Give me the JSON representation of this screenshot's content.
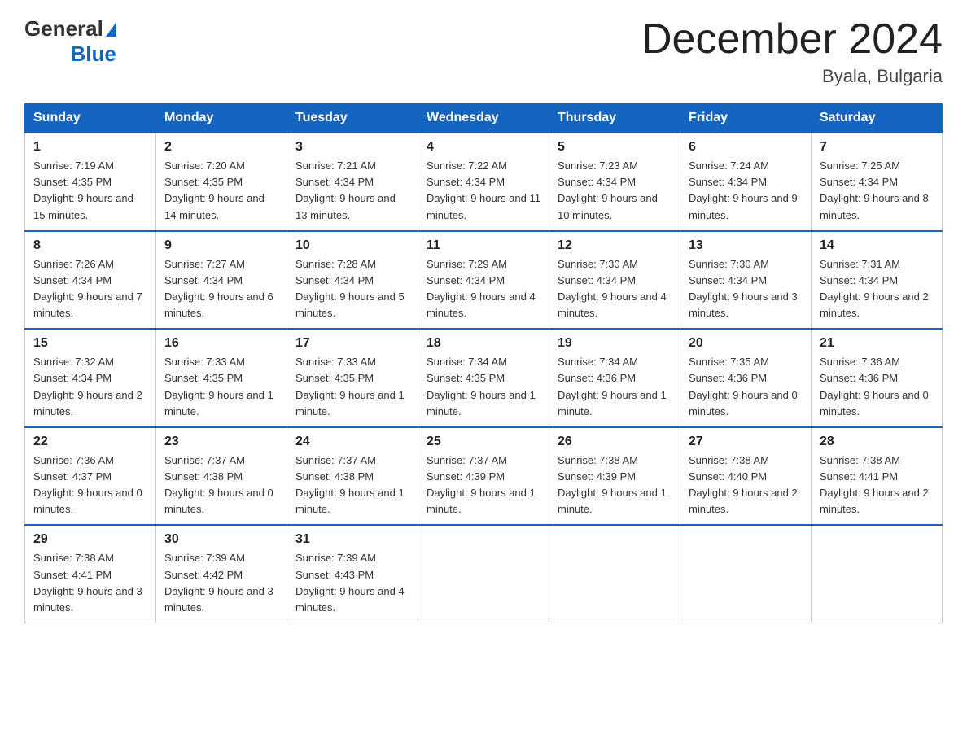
{
  "header": {
    "logo_general": "General",
    "logo_blue": "Blue",
    "title": "December 2024",
    "location": "Byala, Bulgaria"
  },
  "days_of_week": [
    "Sunday",
    "Monday",
    "Tuesday",
    "Wednesday",
    "Thursday",
    "Friday",
    "Saturday"
  ],
  "weeks": [
    [
      {
        "day": "1",
        "sunrise": "7:19 AM",
        "sunset": "4:35 PM",
        "daylight": "9 hours and 15 minutes."
      },
      {
        "day": "2",
        "sunrise": "7:20 AM",
        "sunset": "4:35 PM",
        "daylight": "9 hours and 14 minutes."
      },
      {
        "day": "3",
        "sunrise": "7:21 AM",
        "sunset": "4:34 PM",
        "daylight": "9 hours and 13 minutes."
      },
      {
        "day": "4",
        "sunrise": "7:22 AM",
        "sunset": "4:34 PM",
        "daylight": "9 hours and 11 minutes."
      },
      {
        "day": "5",
        "sunrise": "7:23 AM",
        "sunset": "4:34 PM",
        "daylight": "9 hours and 10 minutes."
      },
      {
        "day": "6",
        "sunrise": "7:24 AM",
        "sunset": "4:34 PM",
        "daylight": "9 hours and 9 minutes."
      },
      {
        "day": "7",
        "sunrise": "7:25 AM",
        "sunset": "4:34 PM",
        "daylight": "9 hours and 8 minutes."
      }
    ],
    [
      {
        "day": "8",
        "sunrise": "7:26 AM",
        "sunset": "4:34 PM",
        "daylight": "9 hours and 7 minutes."
      },
      {
        "day": "9",
        "sunrise": "7:27 AM",
        "sunset": "4:34 PM",
        "daylight": "9 hours and 6 minutes."
      },
      {
        "day": "10",
        "sunrise": "7:28 AM",
        "sunset": "4:34 PM",
        "daylight": "9 hours and 5 minutes."
      },
      {
        "day": "11",
        "sunrise": "7:29 AM",
        "sunset": "4:34 PM",
        "daylight": "9 hours and 4 minutes."
      },
      {
        "day": "12",
        "sunrise": "7:30 AM",
        "sunset": "4:34 PM",
        "daylight": "9 hours and 4 minutes."
      },
      {
        "day": "13",
        "sunrise": "7:30 AM",
        "sunset": "4:34 PM",
        "daylight": "9 hours and 3 minutes."
      },
      {
        "day": "14",
        "sunrise": "7:31 AM",
        "sunset": "4:34 PM",
        "daylight": "9 hours and 2 minutes."
      }
    ],
    [
      {
        "day": "15",
        "sunrise": "7:32 AM",
        "sunset": "4:34 PM",
        "daylight": "9 hours and 2 minutes."
      },
      {
        "day": "16",
        "sunrise": "7:33 AM",
        "sunset": "4:35 PM",
        "daylight": "9 hours and 1 minute."
      },
      {
        "day": "17",
        "sunrise": "7:33 AM",
        "sunset": "4:35 PM",
        "daylight": "9 hours and 1 minute."
      },
      {
        "day": "18",
        "sunrise": "7:34 AM",
        "sunset": "4:35 PM",
        "daylight": "9 hours and 1 minute."
      },
      {
        "day": "19",
        "sunrise": "7:34 AM",
        "sunset": "4:36 PM",
        "daylight": "9 hours and 1 minute."
      },
      {
        "day": "20",
        "sunrise": "7:35 AM",
        "sunset": "4:36 PM",
        "daylight": "9 hours and 0 minutes."
      },
      {
        "day": "21",
        "sunrise": "7:36 AM",
        "sunset": "4:36 PM",
        "daylight": "9 hours and 0 minutes."
      }
    ],
    [
      {
        "day": "22",
        "sunrise": "7:36 AM",
        "sunset": "4:37 PM",
        "daylight": "9 hours and 0 minutes."
      },
      {
        "day": "23",
        "sunrise": "7:37 AM",
        "sunset": "4:38 PM",
        "daylight": "9 hours and 0 minutes."
      },
      {
        "day": "24",
        "sunrise": "7:37 AM",
        "sunset": "4:38 PM",
        "daylight": "9 hours and 1 minute."
      },
      {
        "day": "25",
        "sunrise": "7:37 AM",
        "sunset": "4:39 PM",
        "daylight": "9 hours and 1 minute."
      },
      {
        "day": "26",
        "sunrise": "7:38 AM",
        "sunset": "4:39 PM",
        "daylight": "9 hours and 1 minute."
      },
      {
        "day": "27",
        "sunrise": "7:38 AM",
        "sunset": "4:40 PM",
        "daylight": "9 hours and 2 minutes."
      },
      {
        "day": "28",
        "sunrise": "7:38 AM",
        "sunset": "4:41 PM",
        "daylight": "9 hours and 2 minutes."
      }
    ],
    [
      {
        "day": "29",
        "sunrise": "7:38 AM",
        "sunset": "4:41 PM",
        "daylight": "9 hours and 3 minutes."
      },
      {
        "day": "30",
        "sunrise": "7:39 AM",
        "sunset": "4:42 PM",
        "daylight": "9 hours and 3 minutes."
      },
      {
        "day": "31",
        "sunrise": "7:39 AM",
        "sunset": "4:43 PM",
        "daylight": "9 hours and 4 minutes."
      },
      null,
      null,
      null,
      null
    ]
  ]
}
